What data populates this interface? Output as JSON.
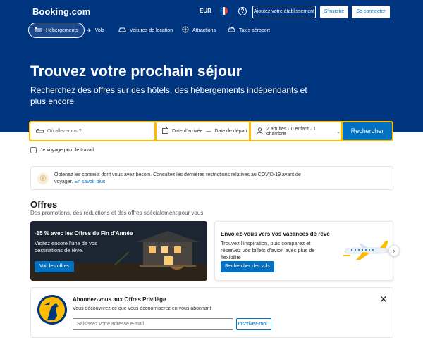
{
  "header": {
    "logo": "Booking.com",
    "currency": "EUR",
    "help_icon": "?",
    "add_property": "Ajoutez votre établissement",
    "register": "S'inscrire",
    "login": "Se connecter",
    "flag_colors": [
      "#0055a4",
      "#ffffff",
      "#ef4135"
    ]
  },
  "nav": {
    "items": [
      {
        "label": "Hébergements",
        "icon": "bed-icon",
        "active": true
      },
      {
        "label": "Vols",
        "icon": "plane-icon"
      },
      {
        "label": "Voitures de location",
        "icon": "car-icon"
      },
      {
        "label": "Attractions",
        "icon": "attraction-icon"
      },
      {
        "label": "Taxis aéroport",
        "icon": "taxi-icon"
      }
    ]
  },
  "hero": {
    "title": "Trouvez votre prochain séjour",
    "subtitle": "Recherchez des offres sur des hôtels, des hébergements indépendants et plus encore"
  },
  "search": {
    "destination_placeholder": "Où allez-vous ?",
    "checkin": "Date d'arrivée",
    "dash": "—",
    "checkout": "Date de départ",
    "occupancy": "2 adultes · 0 enfant · 1 chambre",
    "button": "Rechercher"
  },
  "work_travel": "Je voyage pour le travail",
  "covid": {
    "text": "Obtenez les conseils dont vous avez besoin. Consultez les dernières restrictions relatives au COVID-19 avant de voyager.",
    "link": "En savoir plus"
  },
  "offres": {
    "title": "Offres",
    "subtitle": "Des promotions, des réductions et des offres spécialement pour vous",
    "cards": [
      {
        "title": "-15 % avec les Offres de Fin d'Année",
        "text": "Visitez encore l'une de vos destinations de rêve.",
        "button": "Voir les offres"
      },
      {
        "title": "Envolez-vous vers vos vacances de rêve",
        "text": "Trouvez l'inspiration, puis comparez et réservez vos billets d'avion avec plus de flexibilité",
        "button": "Rechercher des vols"
      }
    ]
  },
  "promo": {
    "title": "Abonnez-vous aux Offres Privilège",
    "text": "Vous découvrirez ce que vous économiserez en vous abonnant",
    "email_placeholder": "Saisissez votre adresse e-mail",
    "button": "Inscrivez-moi !",
    "close": "✕"
  },
  "colors": {
    "brand_blue": "#003580",
    "action_blue": "#0071c2",
    "search_yellow": "#febb02"
  }
}
